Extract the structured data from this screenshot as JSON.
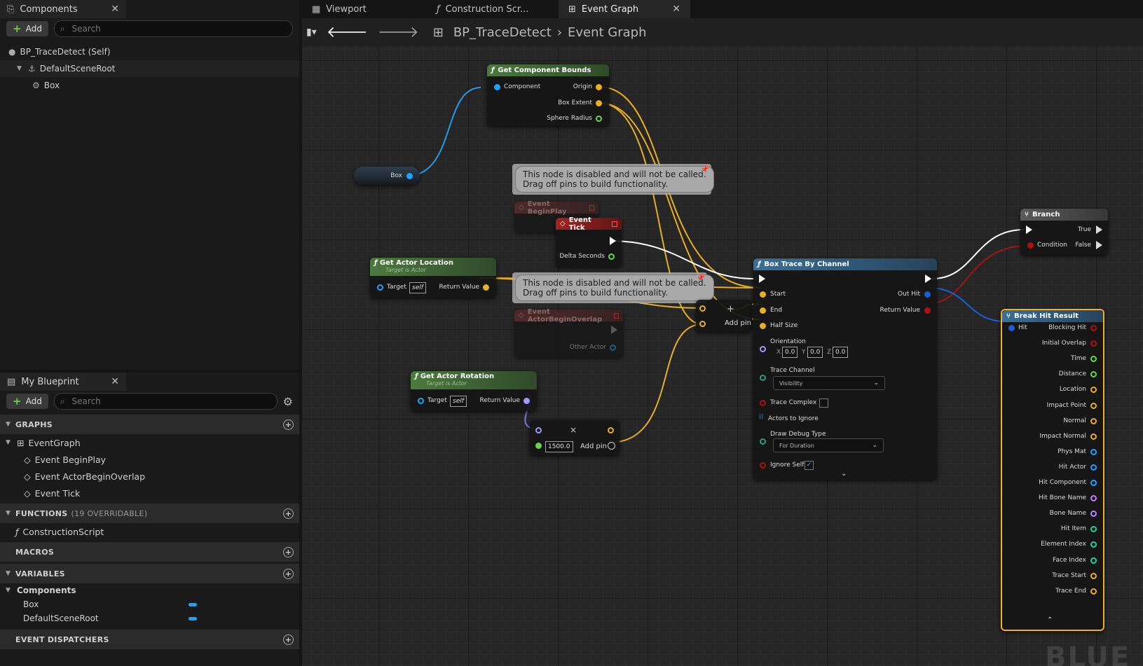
{
  "components_panel": {
    "tab_label": "Components",
    "add_label": "Add",
    "search_placeholder": "Search",
    "tree": {
      "root": "BP_TraceDetect (Self)",
      "child": "DefaultSceneRoot",
      "leaf": "Box"
    }
  },
  "my_blueprint": {
    "tab_label": "My Blueprint",
    "add_label": "Add",
    "search_placeholder": "Search",
    "graphs_header": "GRAPHS",
    "graph_name": "EventGraph",
    "events": [
      "Event BeginPlay",
      "Event ActorBeginOverlap",
      "Event Tick"
    ],
    "functions_header": "FUNCTIONS",
    "functions_count": "(19 OVERRIDABLE)",
    "function_name": "ConstructionScript",
    "macros_header": "MACROS",
    "variables_header": "VARIABLES",
    "components_group": "Components",
    "variables": [
      "Box",
      "DefaultSceneRoot"
    ],
    "dispatchers_header": "EVENT DISPATCHERS"
  },
  "tabs": [
    "Viewport",
    "Construction Scr...",
    "Event Graph"
  ],
  "breadcrumb": {
    "blueprint": "BP_TraceDetect",
    "graph": "Event Graph"
  },
  "colors": {
    "green_node": "#4c7a3e",
    "blue_node": "#3c6e96",
    "event_node": "#a32222",
    "selection": "#f0b020",
    "struct_pin": "#e8b020",
    "object_pin": "#1ea2ff",
    "bool_pin": "#b01010",
    "float_pin": "#6ad44a"
  },
  "nodes": {
    "get_component_bounds": {
      "title": "Get Component Bounds",
      "component": "Component",
      "origin": "Origin",
      "box_extent": "Box Extent",
      "sphere_radius": "Sphere Radius"
    },
    "box_var": {
      "label": "Box"
    },
    "comment_text": "This node is disabled and will not be called.\nDrag off pins to build functionality.",
    "event_beginplay": {
      "title": "Event BeginPlay"
    },
    "event_tick": {
      "title": "Event Tick",
      "delta": "Delta Seconds"
    },
    "get_actor_location": {
      "title": "Get Actor Location",
      "subtitle": "Target is Actor",
      "target": "Target",
      "self": "self",
      "return": "Return Value"
    },
    "event_overlap": {
      "title": "Event ActorBeginOverlap",
      "other": "Other Actor"
    },
    "add_node": {
      "label": "Add pin"
    },
    "get_actor_rotation": {
      "title": "Get Actor Rotation",
      "subtitle": "Target is Actor",
      "target": "Target",
      "self": "self",
      "return": "Return Value"
    },
    "multiply_node": {
      "value": "1500.0",
      "add_pin": "Add pin"
    },
    "box_trace": {
      "title": "Box Trace By Channel",
      "start": "Start",
      "end": "End",
      "half_size": "Half Size",
      "orientation": "Orientation",
      "x_label": "X",
      "y_label": "Y",
      "z_label": "Z",
      "x": "0.0",
      "y": "0.0",
      "z": "0.0",
      "trace_channel": "Trace Channel",
      "channel_value": "Visibility",
      "trace_complex": "Trace Complex",
      "actors_ignore": "Actors to Ignore",
      "draw_debug": "Draw Debug Type",
      "debug_value": "For Duration",
      "ignore_self": "Ignore Self",
      "out_hit": "Out Hit",
      "return_value": "Return Value"
    },
    "branch": {
      "title": "Branch",
      "condition": "Condition",
      "true": "True",
      "false": "False"
    },
    "break_hit": {
      "title": "Break Hit Result",
      "hit": "Hit",
      "outputs": [
        {
          "label": "Blocking Hit",
          "color": "#b01010"
        },
        {
          "label": "Initial Overlap",
          "color": "#b01010"
        },
        {
          "label": "Time",
          "color": "#6ad44a"
        },
        {
          "label": "Distance",
          "color": "#6ad44a"
        },
        {
          "label": "Location",
          "color": "#e8b020"
        },
        {
          "label": "Impact Point",
          "color": "#e8b020"
        },
        {
          "label": "Normal",
          "color": "#e8b020"
        },
        {
          "label": "Impact Normal",
          "color": "#e8b020"
        },
        {
          "label": "Phys Mat",
          "color": "#1ea2ff"
        },
        {
          "label": "Hit Actor",
          "color": "#1ea2ff"
        },
        {
          "label": "Hit Component",
          "color": "#1ea2ff"
        },
        {
          "label": "Hit Bone Name",
          "color": "#c77dff"
        },
        {
          "label": "Bone Name",
          "color": "#c77dff"
        },
        {
          "label": "Hit Item",
          "color": "#1fd1a0"
        },
        {
          "label": "Element Index",
          "color": "#1fd1a0"
        },
        {
          "label": "Face Index",
          "color": "#1fd1a0"
        },
        {
          "label": "Trace Start",
          "color": "#e8b020"
        },
        {
          "label": "Trace End",
          "color": "#e8b020"
        }
      ]
    }
  },
  "watermark": "BLUE"
}
